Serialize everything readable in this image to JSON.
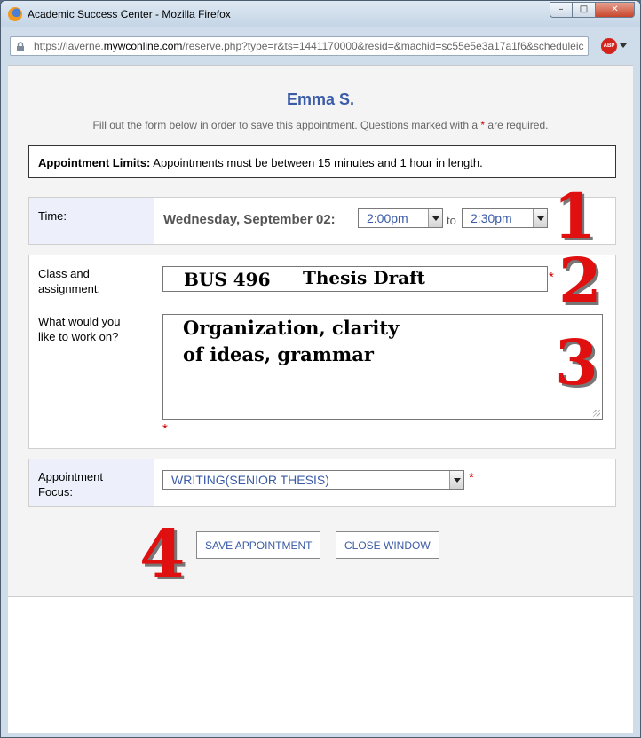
{
  "window": {
    "title": "Academic Success Center - Mozilla Firefox",
    "controls": {
      "minimize": "–",
      "maximize": "□",
      "close": "✕"
    }
  },
  "urlbar": {
    "prefix": "https://laverne.",
    "domain": "mywconline.com",
    "rest": "/reserve.php?type=r&ts=1441170000&resid=&machid=sc55e5e3a17a1f6&scheduleic",
    "icon": "lock-icon"
  },
  "addon": {
    "label": "ABP"
  },
  "form": {
    "consultant_name": "Emma S.",
    "instructions_before": "Fill out the form below in order to save this appointment. Questions marked with a ",
    "required_marker": "*",
    "instructions_after": " are required.",
    "limits_label": "Appointment Limits:",
    "limits_text": " Appointments must be between 15 minutes and 1 hour in length.",
    "time": {
      "label": "Time:",
      "date": "Wednesday, September 02:",
      "start": "2:00pm",
      "separator": "to",
      "end": "2:30pm"
    },
    "class_assignment": {
      "label": "Class and assignment:",
      "course": "BUS 496",
      "assignment": "Thesis Draft"
    },
    "work_on": {
      "label": "What would you like to work on?",
      "line1": "Organization, clarity",
      "line2": "of ideas, grammar"
    },
    "focus": {
      "label": "Appointment Focus:",
      "value": "WRITING(SENIOR THESIS)"
    },
    "buttons": {
      "save": "SAVE APPOINTMENT",
      "close": "CLOSE WINDOW"
    }
  },
  "annotations": [
    "1",
    "2",
    "3",
    "4"
  ],
  "colors": {
    "accent": "#3a5ba6",
    "required": "#cc0000",
    "annotation": "#e01010",
    "label_bg": "#edf0fb"
  }
}
